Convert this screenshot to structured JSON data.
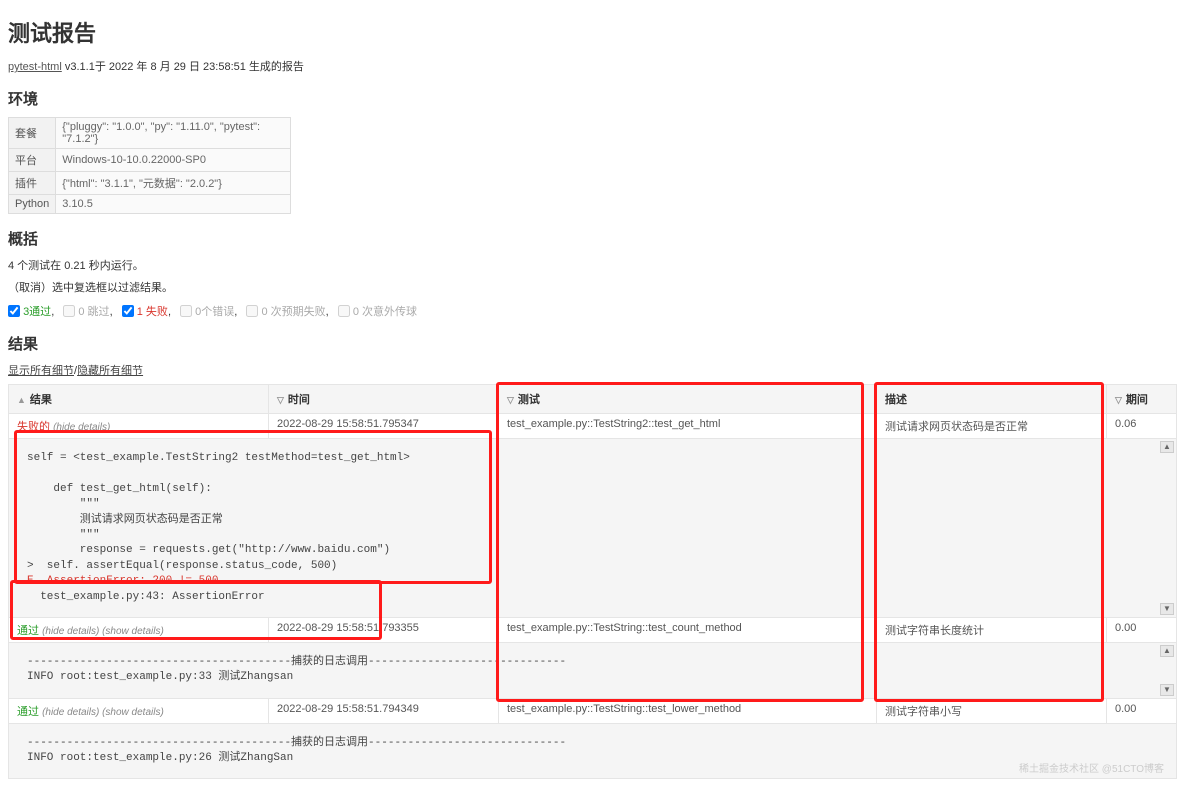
{
  "heading": "测试报告",
  "gen": {
    "lib": "pytest-html",
    "text": "v3.1.1于 2022 年 8 月 29 日 23:58:51 生成的报告"
  },
  "env": {
    "heading": "环境",
    "rows": [
      {
        "k": "套餐",
        "v": "{\"pluggy\": \"1.0.0\", \"py\": \"1.11.0\", \"pytest\": \"7.1.2\"}"
      },
      {
        "k": "平台",
        "v": "Windows-10-10.0.22000-SP0"
      },
      {
        "k": "插件",
        "v": "{\"html\": \"3.1.1\", \"元数据\": \"2.0.2\"}"
      },
      {
        "k": "Python",
        "v": "3.10.5"
      }
    ]
  },
  "summary": {
    "heading": "概括",
    "line1": "4 个测试在 0.21 秒内运行。",
    "line2": "（取消）选中复选框以过滤结果。",
    "filters": {
      "pass": "3通过",
      "skip": "0 跳过",
      "fail": "1 失败",
      "err": "0个错误",
      "xf": "0 次预期失败",
      "xp": "0 次意外传球"
    }
  },
  "results": {
    "heading": "结果",
    "show_all": "显示所有细节",
    "hide_all": "隐藏所有细节",
    "cols": {
      "result": "结果",
      "time": "时间",
      "test": "测试",
      "desc": "描述",
      "dur": "期间"
    },
    "rows": [
      {
        "result": "失败的",
        "detail": "(hide details)",
        "time": "2022-08-29 15:58:51.795347",
        "test": "test_example.py::TestString2::test_get_html",
        "desc": "测试请求网页状态码是否正常",
        "dur": "0.06"
      },
      {
        "result": "通过",
        "detail": "(hide details) (show details)",
        "time": "2022-08-29 15:58:51.793355",
        "test": "test_example.py::TestString::test_count_method",
        "desc": "测试字符串长度统计",
        "dur": "0.00"
      },
      {
        "result": "通过",
        "detail": "(hide details) (show details)",
        "time": "2022-08-29 15:58:51.794349",
        "test": "test_example.py::TestString::test_lower_method",
        "desc": "测试字符串小写",
        "dur": "0.00"
      }
    ],
    "log1_pre": "self = <test_example.TestString2 testMethod=test_get_html>\n\n    def test_get_html(self):\n        \"\"\"\n        测试请求网页状态码是否正常\n        \"\"\"\n        response = requests.get(\"http://www.baidu.com\")\n>  self. assertEqual(response.status_code, 500)",
    "log1_err": "E  AssertionError: 200 != 500",
    "log1_post": "\n  test_example.py:43: AssertionError",
    "log2": "----------------------------------------捕获的日志调用------------------------------\nINFO root:test_example.py:33 测试Zhangsan",
    "log3": "----------------------------------------捕获的日志调用------------------------------\nINFO root:test_example.py:26 测试ZhangSan"
  },
  "watermark": "稀土掘金技术社区\n@51CTO博客"
}
